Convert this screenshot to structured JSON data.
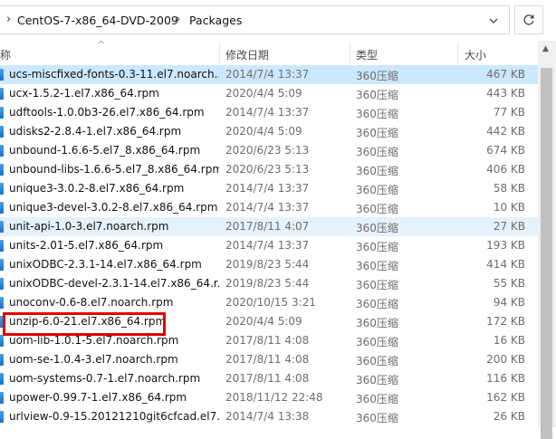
{
  "address": {
    "crumbs": [
      "CentOS-7-x86_64-DVD-2009",
      "Packages"
    ],
    "separator": "›"
  },
  "columns": {
    "name": "称",
    "date": "修改日期",
    "type": "类型",
    "size": "大小"
  },
  "files": [
    {
      "name": "ucs-miscfixed-fonts-0.3-11.el7.noarch....",
      "date": "2014/7/4 13:37",
      "type": "360压缩",
      "size": "467 KB"
    },
    {
      "name": "ucx-1.5.2-1.el7.x86_64.rpm",
      "date": "2020/4/4 5:09",
      "type": "360压缩",
      "size": "443 KB"
    },
    {
      "name": "udftools-1.0.0b3-26.el7.x86_64.rpm",
      "date": "2014/7/4 13:37",
      "type": "360压缩",
      "size": "77 KB"
    },
    {
      "name": "udisks2-2.8.4-1.el7.x86_64.rpm",
      "date": "2020/4/4 5:09",
      "type": "360压缩",
      "size": "442 KB"
    },
    {
      "name": "unbound-1.6.6-5.el7_8.x86_64.rpm",
      "date": "2020/6/23 5:13",
      "type": "360压缩",
      "size": "674 KB"
    },
    {
      "name": "unbound-libs-1.6.6-5.el7_8.x86_64.rpm",
      "date": "2020/6/23 5:13",
      "type": "360压缩",
      "size": "406 KB"
    },
    {
      "name": "unique3-3.0.2-8.el7.x86_64.rpm",
      "date": "2014/7/4 13:37",
      "type": "360压缩",
      "size": "58 KB"
    },
    {
      "name": "unique3-devel-3.0.2-8.el7.x86_64.rpm",
      "date": "2014/7/4 13:37",
      "type": "360压缩",
      "size": "10 KB"
    },
    {
      "name": "unit-api-1.0-3.el7.noarch.rpm",
      "date": "2017/8/11 4:07",
      "type": "360压缩",
      "size": "27 KB"
    },
    {
      "name": "units-2.01-5.el7.x86_64.rpm",
      "date": "2014/7/4 13:37",
      "type": "360压缩",
      "size": "193 KB"
    },
    {
      "name": "unixODBC-2.3.1-14.el7.x86_64.rpm",
      "date": "2019/8/23 5:44",
      "type": "360压缩",
      "size": "414 KB"
    },
    {
      "name": "unixODBC-devel-2.3.1-14.el7.x86_64.r...",
      "date": "2019/8/23 5:44",
      "type": "360压缩",
      "size": "55 KB"
    },
    {
      "name": "unoconv-0.6-8.el7.noarch.rpm",
      "date": "2020/10/15 3:21",
      "type": "360压缩",
      "size": "94 KB"
    },
    {
      "name": "unzip-6.0-21.el7.x86_64.rpm",
      "date": "2020/4/4 5:09",
      "type": "360压缩",
      "size": "172 KB"
    },
    {
      "name": "uom-lib-1.0.1-5.el7.noarch.rpm",
      "date": "2017/8/11 4:08",
      "type": "360压缩",
      "size": "16 KB"
    },
    {
      "name": "uom-se-1.0.4-3.el7.noarch.rpm",
      "date": "2017/8/11 4:08",
      "type": "360压缩",
      "size": "200 KB"
    },
    {
      "name": "uom-systems-0.7-1.el7.noarch.rpm",
      "date": "2017/8/11 4:08",
      "type": "360压缩",
      "size": "116 KB"
    },
    {
      "name": "upower-0.99.7-1.el7.x86_64.rpm",
      "date": "2018/11/12 22:48",
      "type": "360压缩",
      "size": "162 KB"
    },
    {
      "name": "urlview-0.9-15.20121210git6cfcad.el7....",
      "date": "2014/7/4 13:38",
      "type": "360压缩",
      "size": "26 KB"
    }
  ],
  "colors": {
    "selected_row": "#cce8ff",
    "hover_row": "#e5f1fb",
    "annotation_box": "#e00000",
    "file_icon": "#1b6fc9"
  }
}
